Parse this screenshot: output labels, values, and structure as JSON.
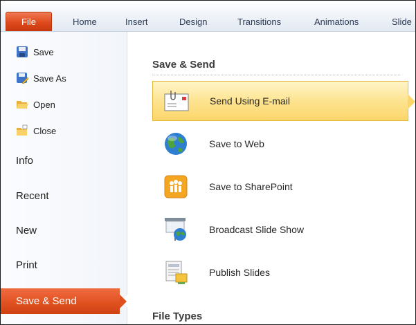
{
  "ribbon": {
    "tabs": [
      "Home",
      "Insert",
      "Design",
      "Transitions",
      "Animations",
      "Slide"
    ],
    "file_label": "File"
  },
  "backstage": {
    "commands": [
      {
        "label": "Save",
        "icon": "save-icon"
      },
      {
        "label": "Save As",
        "icon": "save-as-icon"
      },
      {
        "label": "Open",
        "icon": "open-folder-icon"
      },
      {
        "label": "Close",
        "icon": "close-folder-icon"
      }
    ],
    "tabs": [
      "Info",
      "Recent",
      "New",
      "Print",
      "Save & Send"
    ],
    "active_tab": "Save & Send"
  },
  "main": {
    "section1_title": "Save & Send",
    "options": [
      {
        "label": "Send Using E-mail",
        "icon": "email-attachment-icon",
        "selected": true
      },
      {
        "label": "Save to Web",
        "icon": "globe-icon",
        "selected": false
      },
      {
        "label": "Save to SharePoint",
        "icon": "sharepoint-icon",
        "selected": false
      },
      {
        "label": "Broadcast Slide Show",
        "icon": "broadcast-icon",
        "selected": false
      },
      {
        "label": "Publish Slides",
        "icon": "publish-slides-icon",
        "selected": false
      }
    ],
    "section2_title": "File Types"
  },
  "colors": {
    "file_tab": "#de4a1c",
    "active_nav": "#e0501f",
    "selected_option": "#fde28c"
  }
}
